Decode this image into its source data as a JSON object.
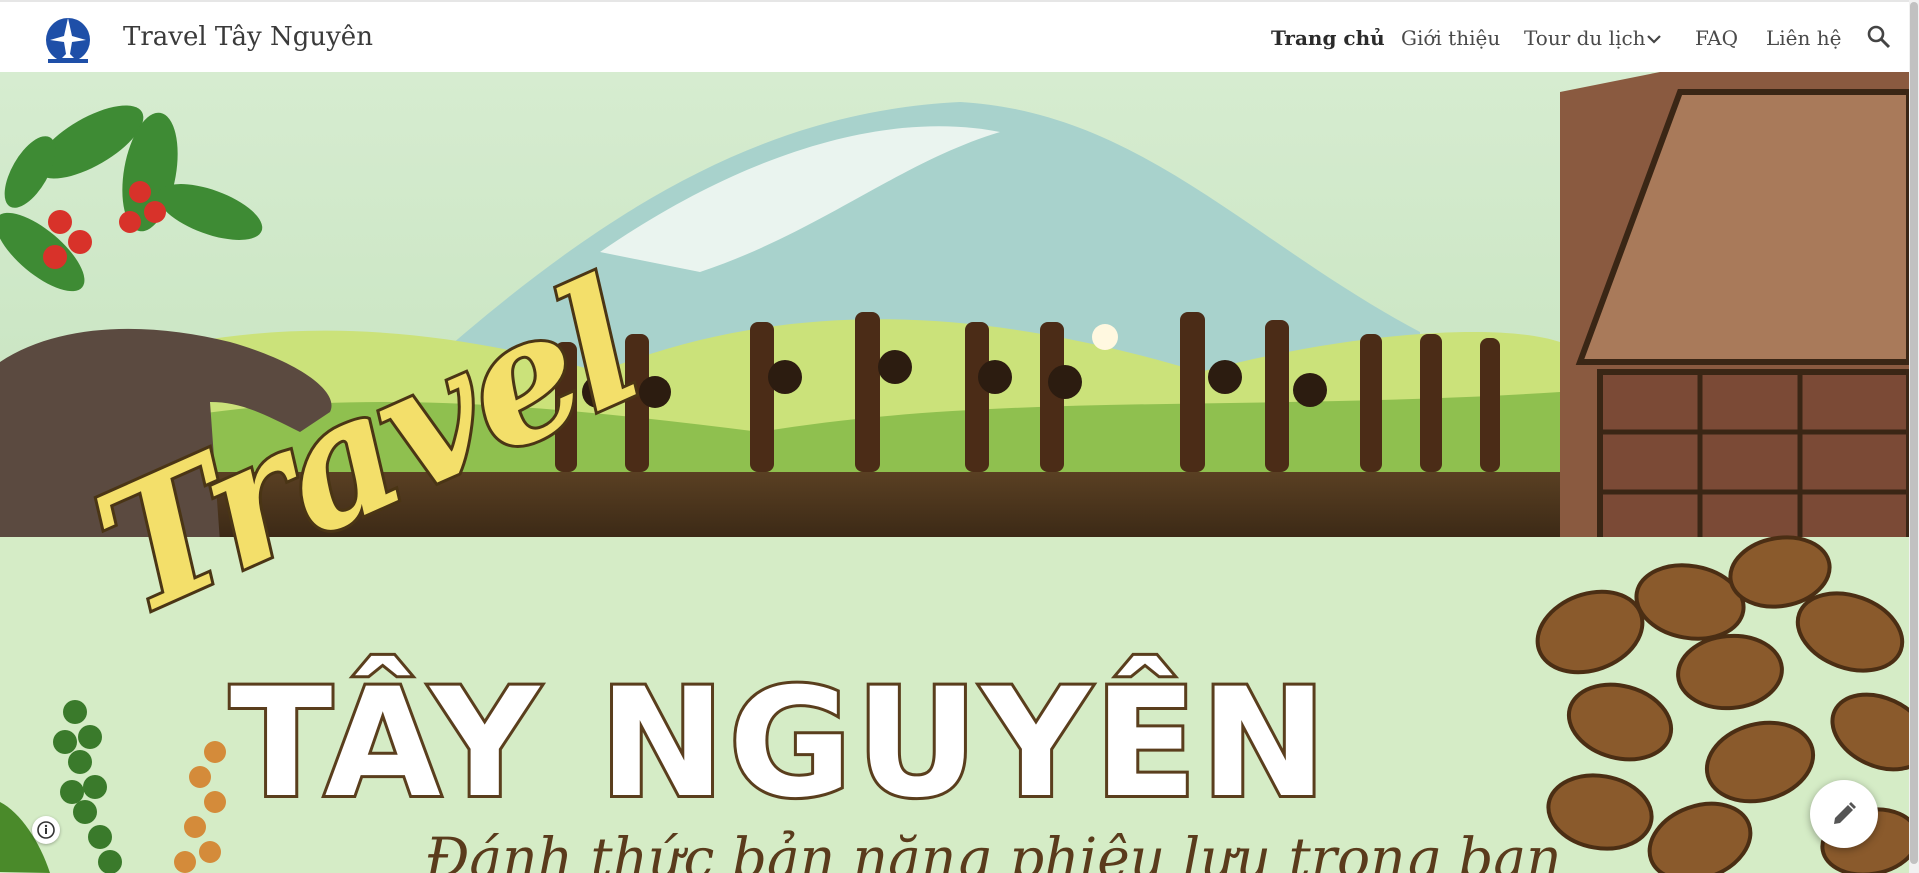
{
  "header": {
    "site_title": "Travel Tây Nguyên",
    "nav": [
      {
        "label": "Trang chủ",
        "active": true
      },
      {
        "label": "Giới thiệu"
      },
      {
        "label": "Tour du lịch",
        "has_dropdown": true
      },
      {
        "label": "FAQ"
      },
      {
        "label": "Liên hệ"
      }
    ],
    "search_icon": "search-icon"
  },
  "hero": {
    "script_title": "Travel",
    "main_title": "TÂY NGUYÊN",
    "tagline": "Đánh thức bản năng phiêu lưu trong bạn"
  },
  "colors": {
    "hero_bg": "#cfe8c1",
    "title_stroke": "#5a3e1d",
    "script_yellow": "#f3df6a",
    "tagline": "#5a3b1c",
    "logo_blue": "#1e4fa8"
  },
  "icons": [
    "info-icon",
    "pencil-icon",
    "chevron-down-icon",
    "search-icon"
  ]
}
